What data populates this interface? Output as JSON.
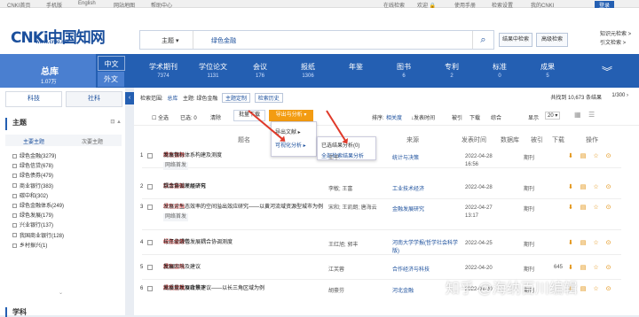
{
  "topbar": {
    "left_links": [
      "CNKI首页",
      "手机版",
      "English",
      "网站地图",
      "帮助中心"
    ],
    "right_links": [
      "欢迎 🔒 ",
      "使用手册",
      "检索设置",
      "我的CNKI",
      "登录"
    ],
    "search_link": "在线检索"
  },
  "header": {
    "logo_mark": "CNKi中国知网",
    "logo_url": "www.cnki.net",
    "search_field": "主题",
    "search_query": "绿色金融",
    "btn_result_search": "结果中检索",
    "btn_advanced": "高级检索",
    "link_knowledge": "知识元检索 >",
    "link_citation": "引文检索 >"
  },
  "nav": {
    "total_label": "总库",
    "total_count": "1.07万",
    "lang_zh": "中文",
    "lang_en": "外文",
    "items": [
      {
        "label": "学术期刊",
        "count": "7374"
      },
      {
        "label": "学位论文",
        "count": "1131"
      },
      {
        "label": "会议",
        "count": "176"
      },
      {
        "label": "报纸",
        "count": "1306"
      },
      {
        "label": "年鉴",
        "count": ""
      },
      {
        "label": "图书",
        "count": "6"
      },
      {
        "label": "专利",
        "count": "2"
      },
      {
        "label": "标准",
        "count": "0"
      },
      {
        "label": "成果",
        "count": "5"
      }
    ]
  },
  "side": {
    "tab_science": "科技",
    "tab_social": "社科",
    "facet_title": "主题",
    "facet_tab_main": "主要主题",
    "facet_tab_sub": "次要主题",
    "items": [
      "绿色金融(3279)",
      "绿色信贷(678)",
      "绿色债券(479)",
      "商业银行(383)",
      "碳中和(302)",
      "绿色金融体系(249)",
      "绿色发展(179)",
      "兴业银行(137)",
      "我国商业银行(128)",
      "乡村振兴(1)"
    ],
    "section2": "学科"
  },
  "results": {
    "crumb_label": "检索范围:",
    "crumb_scope": "总库",
    "crumb_query": "主题: 绿色金融",
    "crumb_tag1": "主题定制",
    "crumb_tag2": "检索历史",
    "total_text": "共找到 10,673 条结果",
    "pager": "1/300",
    "select_all": "全选",
    "selected": "已选: 0",
    "clear": "清除",
    "batch_download": "批量下载",
    "export": "导出与分析 ▾",
    "sort_label": "排序:",
    "sort_relevance": "相关度",
    "sort_date": "↓发表时间",
    "sort_cited": "被引",
    "sort_download": "下载",
    "sort_composite": "综合",
    "display": "显示",
    "display_n": "20 ▾",
    "menu_export": "导出文献",
    "menu_visual": "可视化分析",
    "menu_selected": "已选结果分析(0)",
    "menu_all": "全部检索结果分析",
    "columns": [
      "题名",
      "来源",
      "发表时间",
      "数据库",
      "被引",
      "下载",
      "操作"
    ],
    "rows": [
      {
        "no": "1",
        "pre": "商业银行",
        "hl": "绿色金融",
        "post": "发展指标体系构建及测度",
        "badge": "网络首发",
        "author": "王干",
        "source": "统计与决策",
        "date": "2022-04-28 16:56",
        "db": "期刊",
        "dl": ""
      },
      {
        "no": "2",
        "pre": "京津冀循环经济与",
        "hl": "绿色金融",
        "post": "耦合协调发展研究",
        "badge": "",
        "author": "李敏; 王富",
        "source": "工业技术经济",
        "date": "2022-04-28",
        "db": "期刊",
        "dl": ""
      },
      {
        "no": "3",
        "pre": "",
        "hl": "绿色金融",
        "post": "发展对生态效率的空间溢出效应研究——以黄河流域资源型城市为例",
        "badge": "网络首发",
        "author": "宋和; 王凯朗; 唐海云",
        "source": "金融发展研究",
        "date": "2022-04-27 13:17",
        "db": "期刊",
        "dl": ""
      },
      {
        "no": "4",
        "pre": "长江经济带",
        "hl": "绿色金融",
        "post": "与产业绿色发展耦合协调测度",
        "badge": "",
        "author": "王红旭; 郭丰",
        "source": "河南大学学报(哲学社会科学版)",
        "date": "2022-04-25",
        "db": "期刊",
        "dl": ""
      },
      {
        "no": "5",
        "pre": "我国",
        "hl": "绿色金融",
        "post": "发展困境及建议",
        "badge": "",
        "author": "江芙蓉",
        "source": "合作经济与科技",
        "date": "2022-04-20",
        "db": "期刊",
        "dl": "645"
      },
      {
        "no": "6",
        "pre": "高质量发展背景下",
        "hl": "绿色金融",
        "post": "发展现状及政策建议——以长三角区域为例",
        "badge": "",
        "author": "胡豪芬",
        "source": "河北金融",
        "date": "2022-04-20",
        "db": "期刊",
        "dl": ""
      }
    ]
  },
  "watermark": "知乎 @海纳百川编辑"
}
